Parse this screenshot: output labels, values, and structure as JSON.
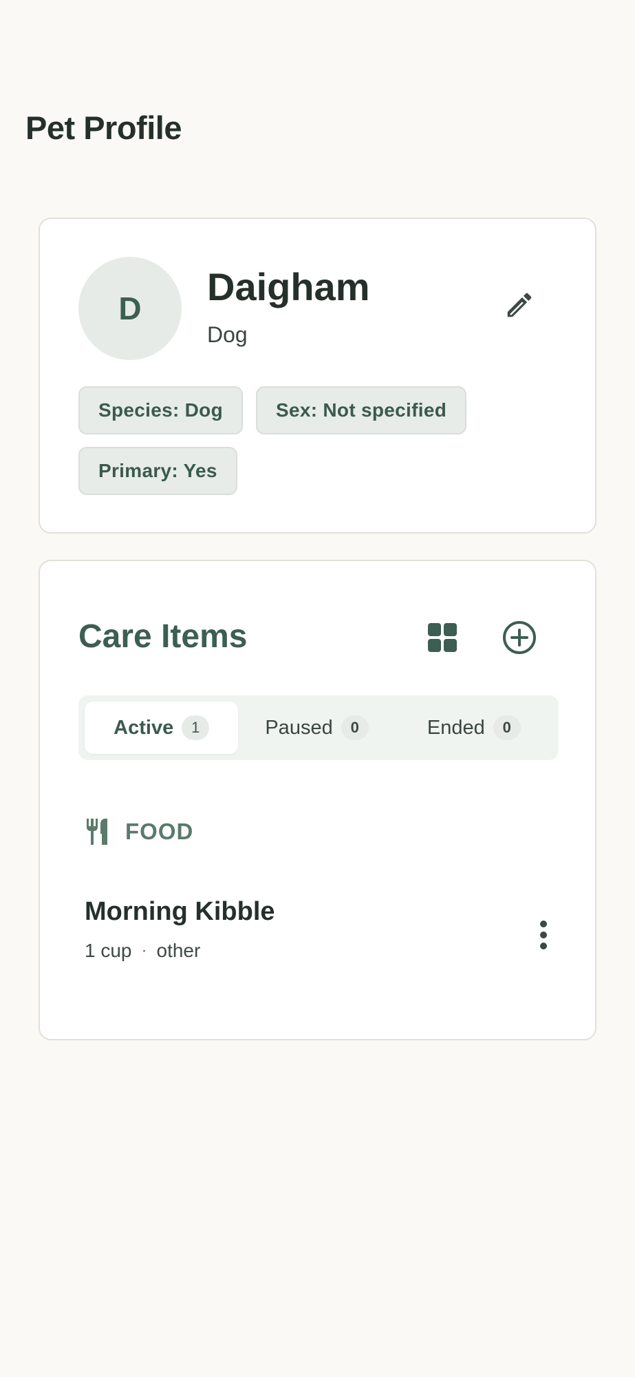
{
  "page": {
    "title": "Pet Profile"
  },
  "pet": {
    "avatar_initial": "D",
    "name": "Daigham",
    "species": "Dog",
    "chips": [
      "Species: Dog",
      "Sex: Not specified",
      "Primary: Yes"
    ],
    "edit_icon": "pencil-icon"
  },
  "care": {
    "title": "Care Items",
    "grid_icon": "grid-icon",
    "add_icon": "add-circle-icon",
    "tabs": [
      {
        "label": "Active",
        "count": "1",
        "selected": true
      },
      {
        "label": "Paused",
        "count": "0",
        "selected": false
      },
      {
        "label": "Ended",
        "count": "0",
        "selected": false
      }
    ],
    "section": {
      "icon": "utensils-icon",
      "label": "FOOD"
    },
    "items": [
      {
        "name": "Morning Kibble",
        "amount": "1 cup",
        "separator": "·",
        "type": "other"
      }
    ]
  },
  "colors": {
    "background": "#faf9f6",
    "accent": "#3d5e52",
    "chip_bg": "#e7ece8",
    "card_border": "#e2e0d8"
  }
}
